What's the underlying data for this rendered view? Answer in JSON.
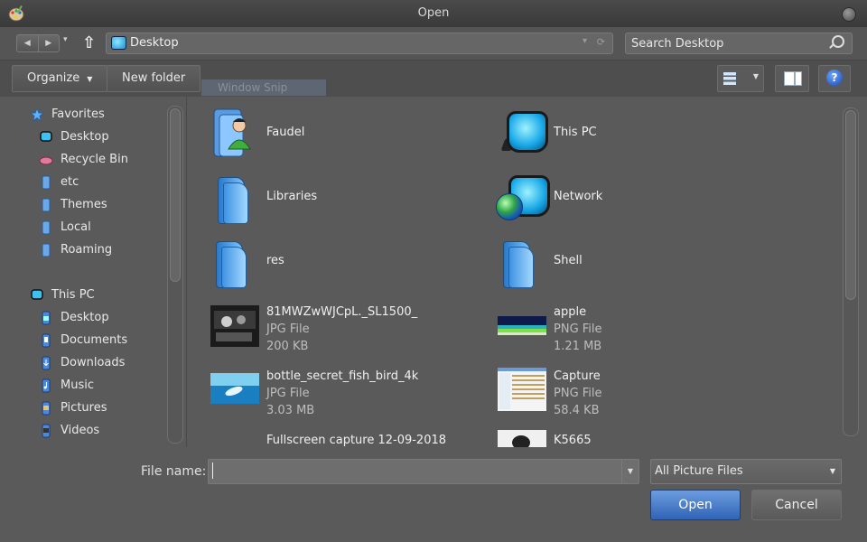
{
  "window": {
    "title": "Open"
  },
  "nav": {
    "back_glyph": "◀",
    "forward_glyph": "▶",
    "recent_glyph": "▾",
    "up_glyph": "⇧",
    "address": "Desktop",
    "search_placeholder": "Search Desktop"
  },
  "toolbar": {
    "organize": "Organize",
    "new_folder": "New folder",
    "help": "?",
    "ghost_label": "Window Snip"
  },
  "sidebar": {
    "favorites_header": "Favorites",
    "favorites": [
      "Desktop",
      "Recycle Bin",
      "etc",
      "Themes",
      "Local",
      "Roaming"
    ],
    "thispc_header": "This PC",
    "thispc": [
      "Desktop",
      "Documents",
      "Downloads",
      "Music",
      "Pictures",
      "Videos"
    ]
  },
  "files": [
    {
      "name": "Faudel",
      "kind": "user-folder"
    },
    {
      "name": "This PC",
      "kind": "computer"
    },
    {
      "name": "Libraries",
      "kind": "folder"
    },
    {
      "name": "Network",
      "kind": "network"
    },
    {
      "name": "res",
      "kind": "folder"
    },
    {
      "name": "Shell",
      "kind": "folder"
    },
    {
      "name": "81MWZwWJCpL._SL1500_",
      "type": "JPG File",
      "size": "200 KB"
    },
    {
      "name": "apple",
      "type": "PNG File",
      "size": "1.21 MB"
    },
    {
      "name": "bottle_secret_fish_bird_4k",
      "type": "JPG File",
      "size": "3.03 MB"
    },
    {
      "name": "Capture",
      "type": "PNG File",
      "size": "58.4 KB"
    },
    {
      "name": "Fullscreen capture 12-09-2018"
    },
    {
      "name": "K5665"
    }
  ],
  "bottom": {
    "file_name_label": "File name:",
    "file_name_value": "",
    "filter": "All Picture Files",
    "open": "Open",
    "cancel": "Cancel"
  }
}
